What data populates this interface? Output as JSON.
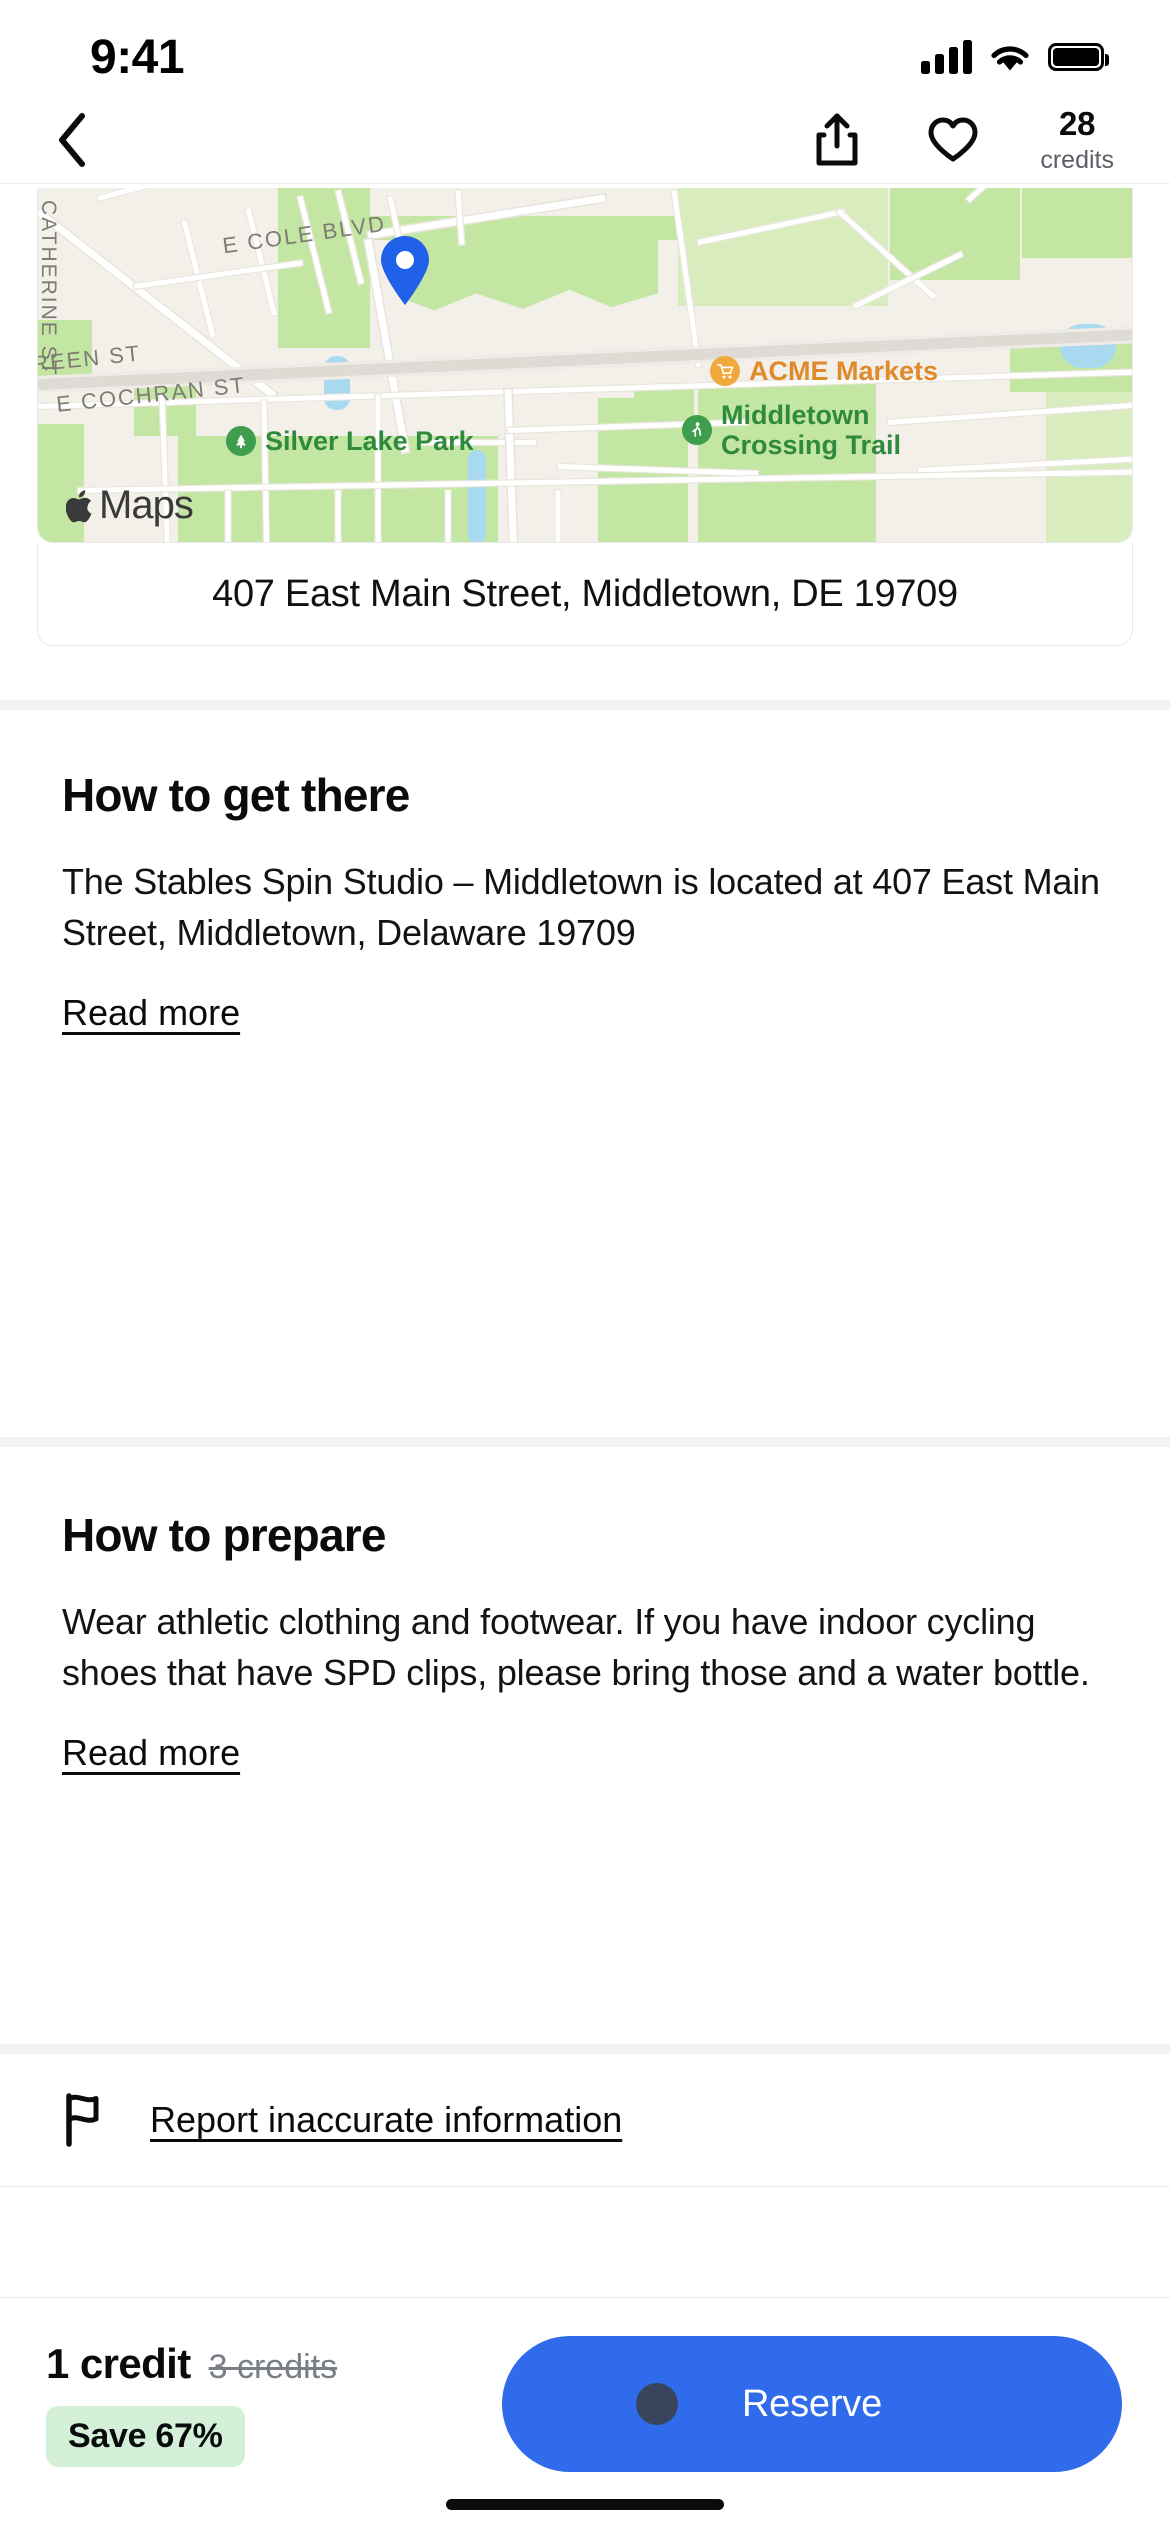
{
  "status_bar": {
    "time": "9:41",
    "cellular_icon": "signal-bars-icon",
    "wifi_icon": "wifi-icon",
    "battery_icon": "battery-full-icon"
  },
  "header": {
    "back_icon": "chevron-left-icon",
    "share_icon": "share-icon",
    "favorite_icon": "heart-outline-icon",
    "credits_count": "28",
    "credits_label": "credits"
  },
  "map": {
    "provider_label": "Maps",
    "provider_logo": "apple-logo-icon",
    "pin_icon": "map-pin-icon",
    "street_labels": [
      "CATHERINE ST",
      "E COLE BLVD",
      "REEN ST",
      "E COCHRAN ST"
    ],
    "pois": [
      {
        "name": "ACME Markets",
        "icon": "shopping-cart-icon",
        "color": "#e8a33d"
      },
      {
        "name": "Middletown Crossing Trail",
        "icon": "walking-icon",
        "color": "#3f9e4d"
      },
      {
        "name": "Silver Lake Park",
        "icon": "park-icon",
        "color": "#3f9e4d"
      }
    ]
  },
  "address": {
    "text": "407 East Main Street, Middletown, DE 19709"
  },
  "sections": [
    {
      "title": "How to get there",
      "body": "The Stables Spin Studio – Middletown is located at 407 East Main Street, Middletown, Delaware 19709",
      "read_more": "Read more"
    },
    {
      "title": "How to prepare",
      "body": "Wear athletic clothing and footwear. If you have indoor cycling shoes that  have SPD clips, please bring those and a water bottle.",
      "read_more": "Read more"
    }
  ],
  "report": {
    "icon": "flag-icon",
    "label": "Report inaccurate information"
  },
  "bottom_bar": {
    "price_current": "1 credit",
    "price_original": "3 credits",
    "save_badge": "Save 67%",
    "reserve_label": "Reserve",
    "accent_color": "#2f6bea",
    "badge_color": "#d4f0d9"
  }
}
